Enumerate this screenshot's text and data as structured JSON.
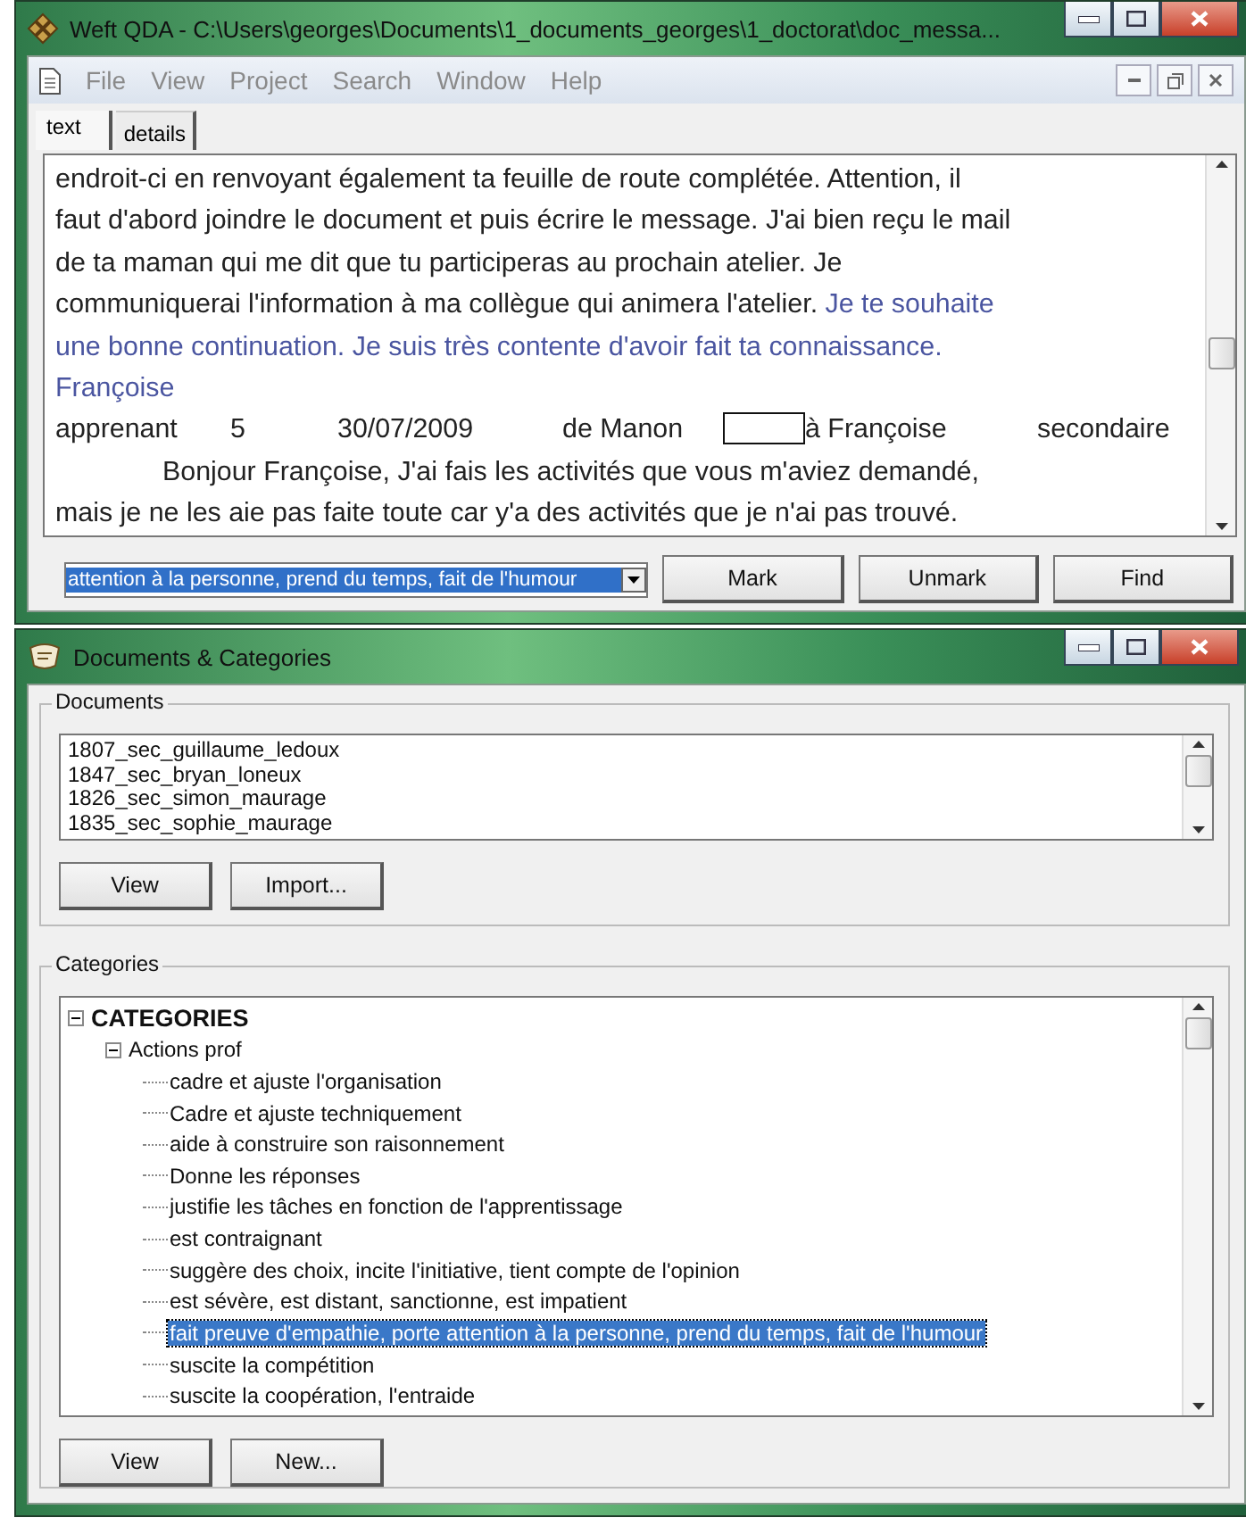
{
  "main_window": {
    "title": "Weft QDA - C:\\Users\\georges\\Documents\\1_documents_georges\\1_doctorat\\doc_messa...",
    "menu": [
      "File",
      "View",
      "Project",
      "Search",
      "Window",
      "Help"
    ],
    "tabs": [
      {
        "label": "text",
        "selected": true
      },
      {
        "label": "details",
        "selected": false
      }
    ],
    "document_lines": [
      {
        "kind": "text",
        "segments": [
          {
            "text": "endroit-ci en renvoyant également ta feuille de route complétée. Attention, il",
            "marked": false
          }
        ]
      },
      {
        "kind": "text",
        "segments": [
          {
            "text": "faut d'abord joindre le document et puis écrire le message. J'ai bien reçu le mail",
            "marked": false
          }
        ]
      },
      {
        "kind": "text",
        "segments": [
          {
            "text": "de ta maman qui me dit que tu participeras au prochain atelier. Je",
            "marked": false
          }
        ]
      },
      {
        "kind": "text",
        "segments": [
          {
            "text": "communiquerai l'information à ma collègue qui animera l'atelier.",
            "marked": false
          },
          {
            "text": " Je te souhaite",
            "marked": true
          }
        ]
      },
      {
        "kind": "text",
        "segments": [
          {
            "text": "une bonne continuation. Je suis très contente d'avoir fait ta connaissance.",
            "marked": true
          }
        ]
      },
      {
        "kind": "text",
        "segments": [
          {
            "text": "Françoise",
            "marked": true
          }
        ]
      },
      {
        "kind": "record",
        "fields": [
          "apprenant",
          "5",
          "30/07/2009",
          "de Manon",
          "à Françoise",
          "secondaire"
        ]
      },
      {
        "kind": "indented",
        "segments": [
          {
            "text": "Bonjour Françoise, J'ai fais les activités que vous m'aviez demandé,",
            "marked": false
          }
        ]
      },
      {
        "kind": "text",
        "segments": [
          {
            "text": "mais je ne les aie pas faite toute car y'a des activités que je n'ai pas trouvé.",
            "marked": false
          }
        ]
      }
    ],
    "category_select": "attention à la personne, prend du temps, fait de l'humour",
    "buttons": [
      "Mark",
      "Unmark",
      "Find"
    ]
  },
  "docs_window": {
    "title": "Documents & Categories",
    "documents_label": "Documents",
    "documents": [
      "1807_sec_guillaume_ledoux",
      "1847_sec_bryan_loneux",
      "1826_sec_simon_maurage",
      "1835_sec_sophie_maurage"
    ],
    "documents_buttons": [
      "View",
      "Import..."
    ],
    "categories_label": "Categories",
    "tree": [
      {
        "label": "CATEGORIES",
        "expanded": true,
        "selected": false,
        "children": [
          {
            "label": "Actions prof",
            "expanded": true,
            "selected": false,
            "children": [
              {
                "label": "cadre et ajuste l'organisation",
                "selected": false
              },
              {
                "label": "Cadre et ajuste techniquement",
                "selected": false
              },
              {
                "label": "aide à construire son raisonnement",
                "selected": false
              },
              {
                "label": "Donne les réponses",
                "selected": false
              },
              {
                "label": "justifie les tâches en fonction de l'apprentissage",
                "selected": false
              },
              {
                "label": "est contraignant",
                "selected": false
              },
              {
                "label": "suggère des choix, incite l'initiative, tient compte de l'opinion",
                "selected": false
              },
              {
                "label": "est sévère, est distant, sanctionne, est impatient",
                "selected": false
              },
              {
                "label": "fait preuve d'empathie, porte attention à la personne, prend du temps, fait de l'humour",
                "selected": true
              },
              {
                "label": "suscite la compétition",
                "selected": false
              },
              {
                "label": "suscite la coopération, l'entraide",
                "selected": false
              }
            ]
          }
        ]
      }
    ],
    "categories_buttons": [
      "View",
      "New..."
    ]
  }
}
